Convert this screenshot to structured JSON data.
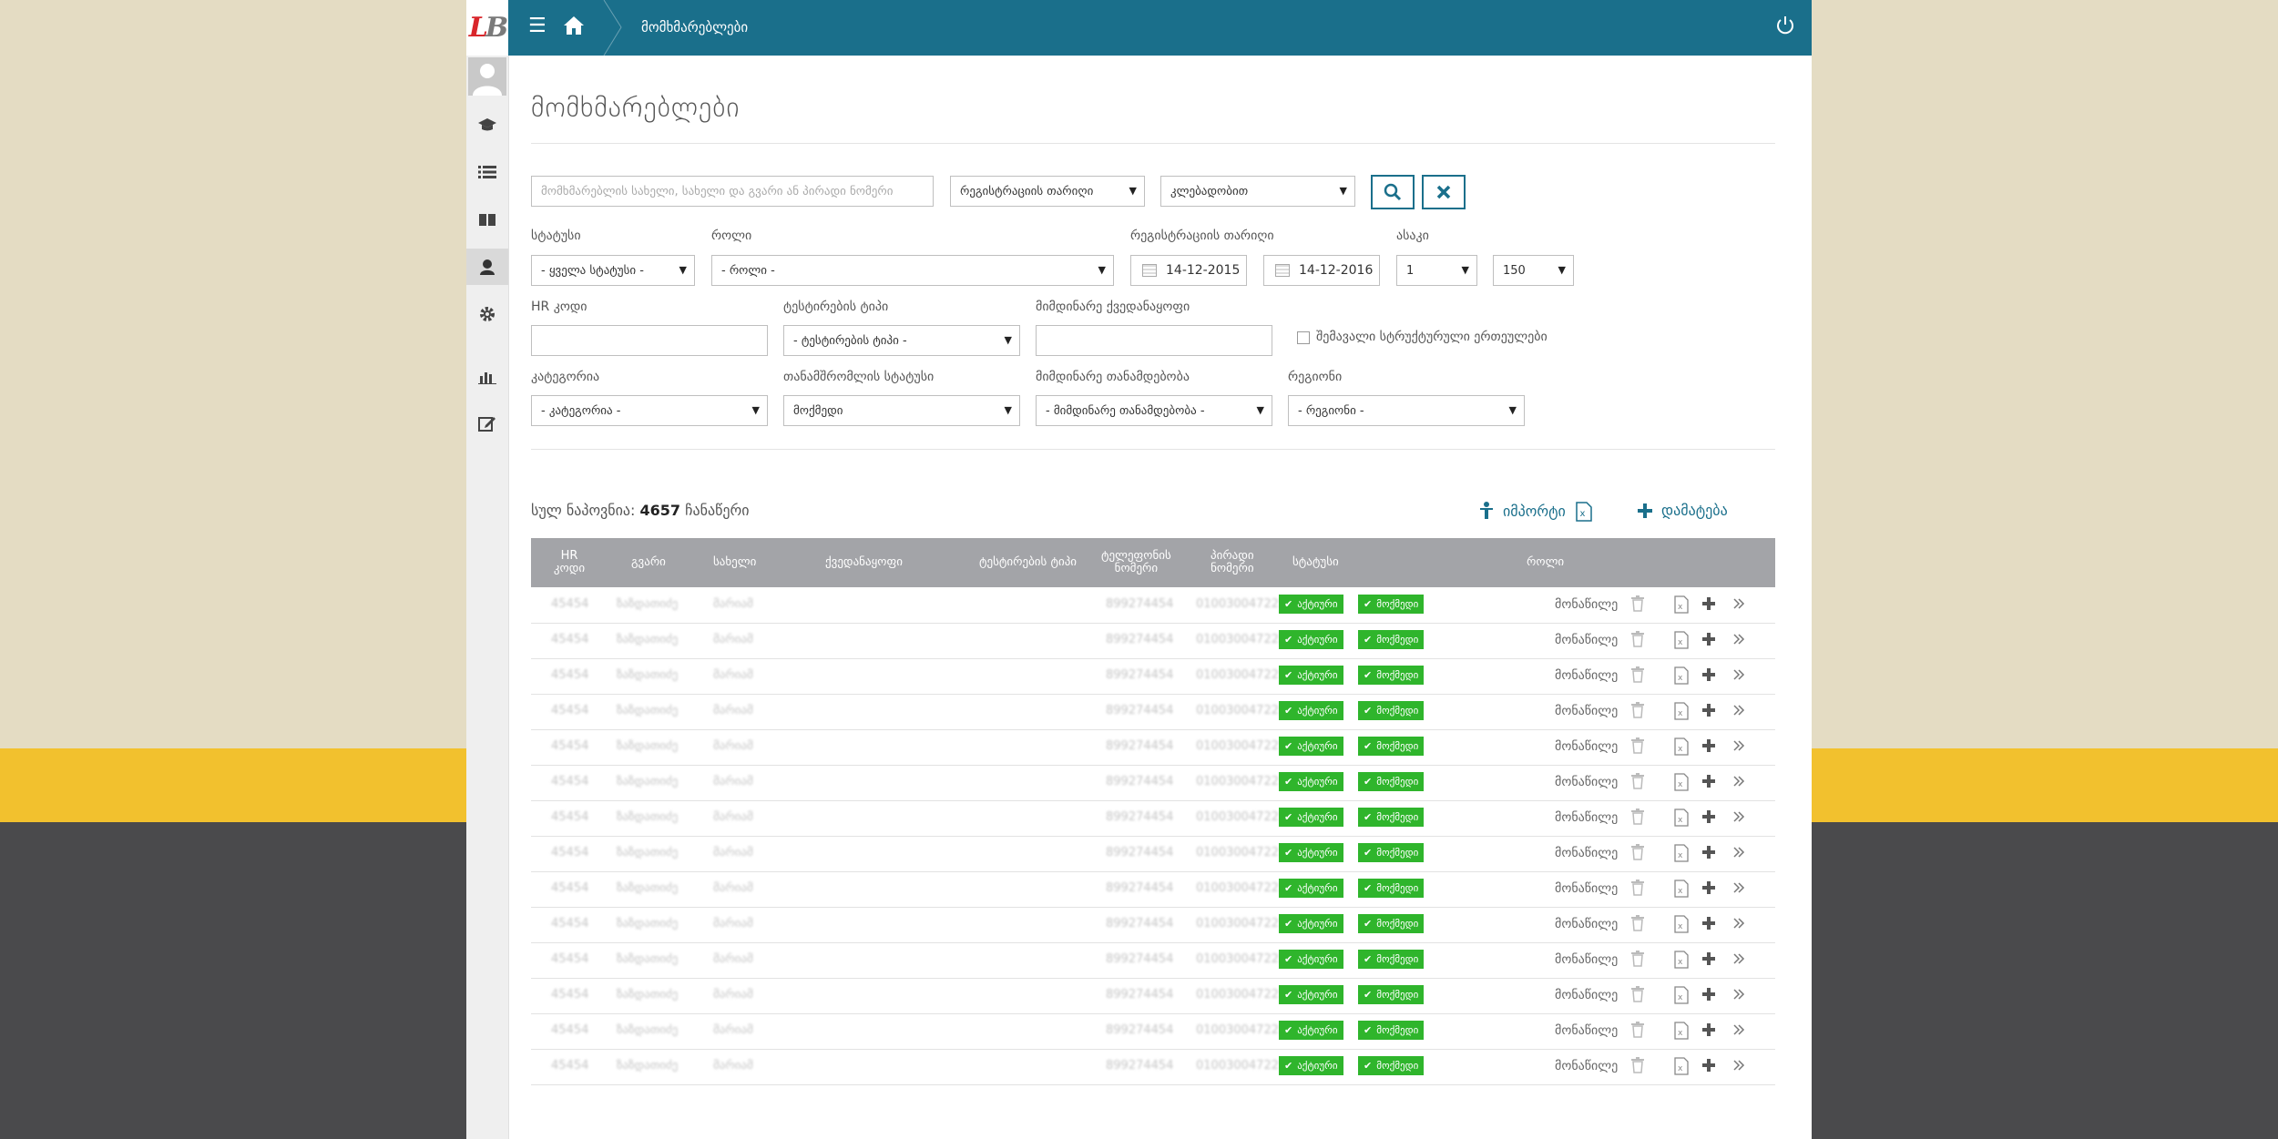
{
  "header": {
    "logo_l": "L",
    "logo_b": "B",
    "breadcrumb": "მომხმარებლები"
  },
  "page": {
    "title": "მომხმარებლები"
  },
  "search": {
    "placeholder": "მომხმარებლის სახელი, სახელი და გვარი ან პირადი ნომერი",
    "sort_field": "რეგისტრაციის თარიღი",
    "sort_order": "კლებადობით"
  },
  "filters": {
    "status_label": "სტატუსი",
    "status_value": "- ყველა სტატუსი -",
    "role_label": "როლი",
    "role_value": "- როლი -",
    "reg_date_label": "რეგისტრაციის თარიღი",
    "date_from": "14-12-2015",
    "date_to": "14-12-2016",
    "age_label": "ასაკი",
    "age_from": "1",
    "age_to": "150",
    "hr_label": "HR კოდი",
    "hr_value": "",
    "testing_type_label": "ტესტირების ტიპი",
    "testing_type_value": "- ტესტირების ტიპი -",
    "current_unit_label": "მიმდინარე ქვედანაყოფი",
    "current_unit_value": "",
    "include_sub_label": "შემავალი სტრუქტურული ერთეულები",
    "category_label": "კატეგორია",
    "category_value": "- კატეგორია -",
    "employee_status_label": "თანამშრომლის სტატუსი",
    "employee_status_value": "მოქმედი",
    "current_position_label": "მიმდინარე თანამდებობა",
    "current_position_value": "- მიმდინარე თანამდებობა -",
    "region_label": "რეგიონი",
    "region_value": "- რეგიონი -"
  },
  "summary": {
    "prefix": "სულ ნაპოვნია:",
    "count": "4657",
    "suffix": "ჩანაწერი"
  },
  "actions": {
    "import_label": "იმპორტი",
    "add_label": "დამატება"
  },
  "table": {
    "headers": {
      "hr_l1": "HR",
      "hr_l2": "კოდი",
      "surname": "გვარი",
      "name": "სახელი",
      "unit": "ქვედანაყოფი",
      "testing_type": "ტესტირების ტიპი",
      "phone_l1": "ტელეფონის",
      "phone_l2": "ნომერი",
      "personal_l1": "პირადი",
      "personal_l2": "ნომერი",
      "status": "სტატუსი",
      "role": "როლი"
    },
    "rows": [
      {
        "hr": "45454",
        "surname": "ზაზდათიძე",
        "name": "მარიამ",
        "phone": "899274454",
        "personal": "01003004722",
        "active": "აქტიური",
        "valid": "მოქმედი",
        "role": "მონაწილე"
      },
      {
        "hr": "45454",
        "surname": "ზაზდათიძე",
        "name": "მარიამ",
        "phone": "899274454",
        "personal": "01003004722",
        "active": "აქტიური",
        "valid": "მოქმედი",
        "role": "მონაწილე"
      },
      {
        "hr": "45454",
        "surname": "ზაზდათიძე",
        "name": "მარიამ",
        "phone": "899274454",
        "personal": "01003004722",
        "active": "აქტიური",
        "valid": "მოქმედი",
        "role": "მონაწილე"
      },
      {
        "hr": "45454",
        "surname": "ზაზდათიძე",
        "name": "მარიამ",
        "phone": "899274454",
        "personal": "01003004722",
        "active": "აქტიური",
        "valid": "მოქმედი",
        "role": "მონაწილე"
      },
      {
        "hr": "45454",
        "surname": "ზაზდათიძე",
        "name": "მარიამ",
        "phone": "899274454",
        "personal": "01003004722",
        "active": "აქტიური",
        "valid": "მოქმედი",
        "role": "მონაწილე"
      },
      {
        "hr": "45454",
        "surname": "ზაზდათიძე",
        "name": "მარიამ",
        "phone": "899274454",
        "personal": "01003004722",
        "active": "აქტიური",
        "valid": "მოქმედი",
        "role": "მონაწილე"
      },
      {
        "hr": "45454",
        "surname": "ზაზდათიძე",
        "name": "მარიამ",
        "phone": "899274454",
        "personal": "01003004722",
        "active": "აქტიური",
        "valid": "მოქმედი",
        "role": "მონაწილე"
      },
      {
        "hr": "45454",
        "surname": "ზაზდათიძე",
        "name": "მარიამ",
        "phone": "899274454",
        "personal": "01003004722",
        "active": "აქტიური",
        "valid": "მოქმედი",
        "role": "მონაწილე"
      },
      {
        "hr": "45454",
        "surname": "ზაზდათიძე",
        "name": "მარიამ",
        "phone": "899274454",
        "personal": "01003004722",
        "active": "აქტიური",
        "valid": "მოქმედი",
        "role": "მონაწილე"
      },
      {
        "hr": "45454",
        "surname": "ზაზდათიძე",
        "name": "მარიამ",
        "phone": "899274454",
        "personal": "01003004722",
        "active": "აქტიური",
        "valid": "მოქმედი",
        "role": "მონაწილე"
      },
      {
        "hr": "45454",
        "surname": "ზაზდათიძე",
        "name": "მარიამ",
        "phone": "899274454",
        "personal": "01003004722",
        "active": "აქტიური",
        "valid": "მოქმედი",
        "role": "მონაწილე"
      },
      {
        "hr": "45454",
        "surname": "ზაზდათიძე",
        "name": "მარიამ",
        "phone": "899274454",
        "personal": "01003004722",
        "active": "აქტიური",
        "valid": "მოქმედი",
        "role": "მონაწილე"
      },
      {
        "hr": "45454",
        "surname": "ზაზდათიძე",
        "name": "მარიამ",
        "phone": "899274454",
        "personal": "01003004722",
        "active": "აქტიური",
        "valid": "მოქმედი",
        "role": "მონაწილე"
      },
      {
        "hr": "45454",
        "surname": "ზაზდათიძე",
        "name": "მარიამ",
        "phone": "899274454",
        "personal": "01003004722",
        "active": "აქტიური",
        "valid": "მოქმედი",
        "role": "მონაწილე"
      }
    ]
  },
  "icons": {
    "sidebar": [
      "avatar",
      "graduation-cap-icon",
      "list-icon",
      "book-icon",
      "user-icon",
      "gear-icon",
      "bar-chart-icon",
      "edit-icon"
    ],
    "row_actions": [
      "trash-icon",
      "excel-icon",
      "plus-icon",
      "double-chevron-right-icon"
    ]
  },
  "colors": {
    "header_bg": "#1a6f8b",
    "badge_green": "#2fb52c",
    "table_header": "#a3a4a8"
  }
}
